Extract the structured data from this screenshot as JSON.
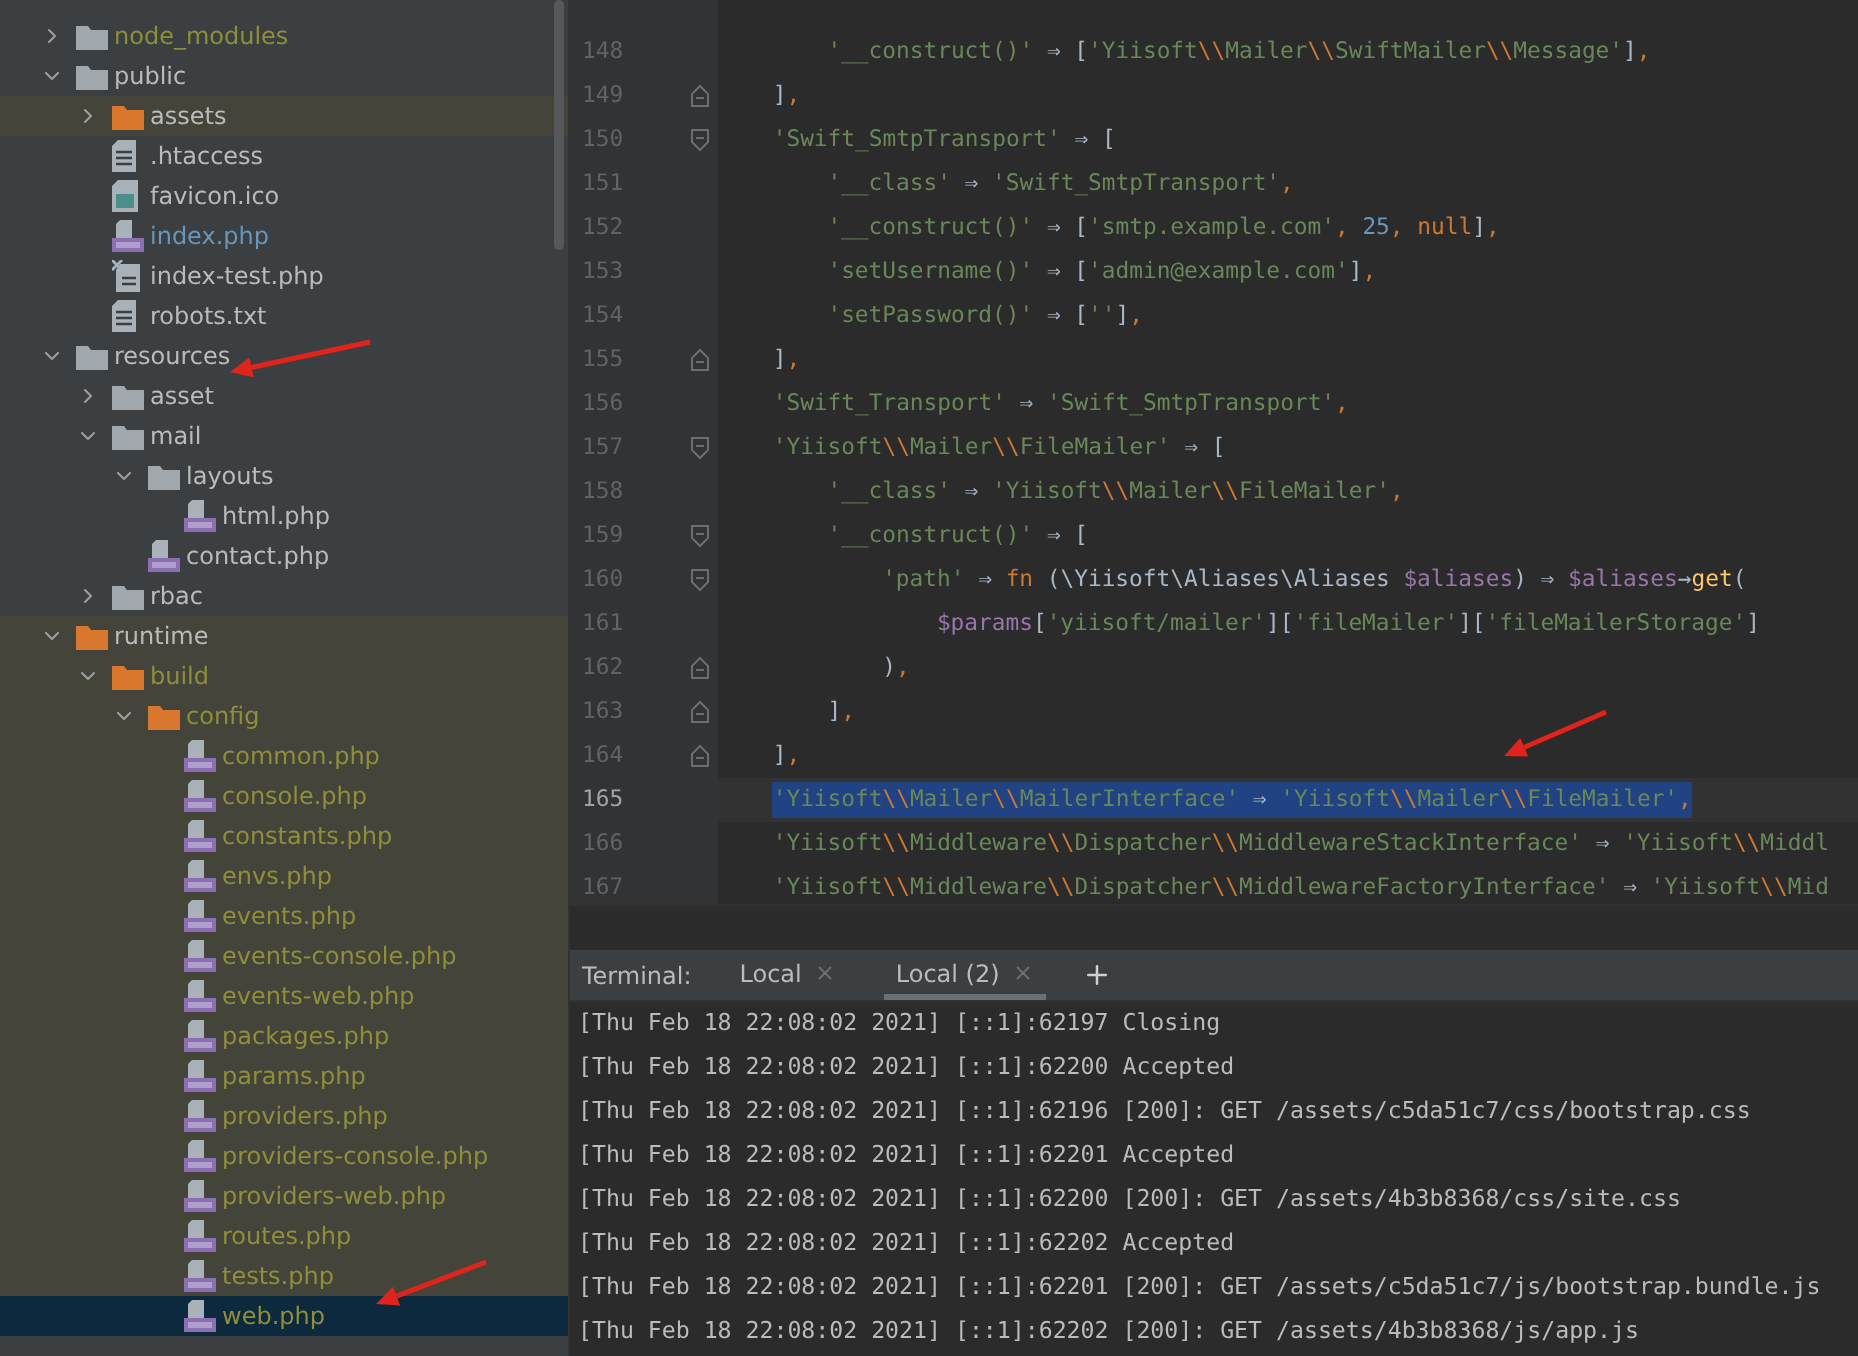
{
  "project_tree": {
    "items": [
      {
        "label": "node_modules",
        "kind": "folder",
        "expanded": false,
        "excluded": false,
        "selected": false,
        "color": "#8f8f3a"
      },
      {
        "label": "public",
        "kind": "folder",
        "expanded": true,
        "excluded": false,
        "selected": false,
        "color": "#bbbbbb",
        "children": [
          {
            "label": "assets",
            "kind": "folder",
            "expanded": false,
            "excluded": true,
            "selected": false,
            "color": "#bbbbbb"
          },
          {
            "label": ".htaccess",
            "kind": "text",
            "selected": false,
            "color": "#bbbbbb"
          },
          {
            "label": "favicon.ico",
            "kind": "image",
            "selected": false,
            "color": "#bbbbbb"
          },
          {
            "label": "index.php",
            "kind": "php",
            "selected": false,
            "color": "#6897bb"
          },
          {
            "label": "index-test.php",
            "kind": "unknown",
            "selected": false,
            "color": "#bbbbbb"
          },
          {
            "label": "robots.txt",
            "kind": "text",
            "selected": false,
            "color": "#bbbbbb"
          }
        ]
      },
      {
        "label": "resources",
        "kind": "folder",
        "expanded": true,
        "excluded": false,
        "selected": false,
        "color": "#bbbbbb",
        "children": [
          {
            "label": "asset",
            "kind": "folder",
            "expanded": false,
            "excluded": false,
            "selected": false,
            "color": "#bbbbbb"
          },
          {
            "label": "mail",
            "kind": "folder",
            "expanded": true,
            "excluded": false,
            "selected": false,
            "color": "#bbbbbb",
            "children": [
              {
                "label": "layouts",
                "kind": "folder",
                "expanded": true,
                "excluded": false,
                "selected": false,
                "color": "#bbbbbb",
                "children": [
                  {
                    "label": "html.php",
                    "kind": "php",
                    "selected": false,
                    "color": "#bbbbbb"
                  }
                ]
              },
              {
                "label": "contact.php",
                "kind": "php",
                "selected": false,
                "color": "#bbbbbb"
              }
            ]
          },
          {
            "label": "rbac",
            "kind": "folder",
            "expanded": false,
            "excluded": false,
            "selected": false,
            "color": "#bbbbbb"
          }
        ]
      },
      {
        "label": "runtime",
        "kind": "folder",
        "expanded": true,
        "excluded": true,
        "selected": false,
        "color": "#bbbbbb",
        "children": [
          {
            "label": "build",
            "kind": "folder",
            "expanded": true,
            "excluded": true,
            "selected": false,
            "color": "#8f8f3a",
            "children": [
              {
                "label": "config",
                "kind": "folder",
                "expanded": true,
                "excluded": true,
                "selected": false,
                "color": "#8f8f3a",
                "children": [
                  {
                    "label": "common.php",
                    "kind": "php",
                    "selected": false,
                    "color": "#8f8f3a"
                  },
                  {
                    "label": "console.php",
                    "kind": "php",
                    "selected": false,
                    "color": "#8f8f3a"
                  },
                  {
                    "label": "constants.php",
                    "kind": "php",
                    "selected": false,
                    "color": "#8f8f3a"
                  },
                  {
                    "label": "envs.php",
                    "kind": "php",
                    "selected": false,
                    "color": "#8f8f3a"
                  },
                  {
                    "label": "events.php",
                    "kind": "php",
                    "selected": false,
                    "color": "#8f8f3a"
                  },
                  {
                    "label": "events-console.php",
                    "kind": "php",
                    "selected": false,
                    "color": "#8f8f3a"
                  },
                  {
                    "label": "events-web.php",
                    "kind": "php",
                    "selected": false,
                    "color": "#8f8f3a"
                  },
                  {
                    "label": "packages.php",
                    "kind": "php",
                    "selected": false,
                    "color": "#8f8f3a"
                  },
                  {
                    "label": "params.php",
                    "kind": "php",
                    "selected": false,
                    "color": "#8f8f3a"
                  },
                  {
                    "label": "providers.php",
                    "kind": "php",
                    "selected": false,
                    "color": "#8f8f3a"
                  },
                  {
                    "label": "providers-console.php",
                    "kind": "php",
                    "selected": false,
                    "color": "#8f8f3a"
                  },
                  {
                    "label": "providers-web.php",
                    "kind": "php",
                    "selected": false,
                    "color": "#8f8f3a"
                  },
                  {
                    "label": "routes.php",
                    "kind": "php",
                    "selected": false,
                    "color": "#8f8f3a"
                  },
                  {
                    "label": "tests.php",
                    "kind": "php",
                    "selected": false,
                    "color": "#8f8f3a"
                  },
                  {
                    "label": "web.php",
                    "kind": "php",
                    "selected": true,
                    "color": "#8f8f3a"
                  }
                ]
              }
            ]
          }
        ]
      }
    ]
  },
  "editor": {
    "lines": [
      {
        "number": "148",
        "fold_start": false,
        "fold_end": false,
        "current": false,
        "selected": false,
        "tokens": [
          {
            "kind": "s",
            "text": "'__construct()'"
          },
          {
            "kind": "p",
            "text": " ⇒ ["
          },
          {
            "kind": "s",
            "text": "'Yiisoft"
          },
          {
            "kind": "e",
            "text": "\\\\"
          },
          {
            "kind": "s",
            "text": "Mailer"
          },
          {
            "kind": "e",
            "text": "\\\\"
          },
          {
            "kind": "s",
            "text": "SwiftMailer"
          },
          {
            "kind": "e",
            "text": "\\\\"
          },
          {
            "kind": "s",
            "text": "Message'"
          },
          {
            "kind": "p",
            "text": "]"
          },
          {
            "kind": "c",
            "text": ","
          }
        ]
      },
      {
        "number": "149",
        "fold_start": false,
        "fold_end": true,
        "current": false,
        "selected": false,
        "tokens": [
          {
            "kind": "p",
            "text": "]"
          },
          {
            "kind": "c",
            "text": ","
          }
        ]
      },
      {
        "number": "150",
        "fold_start": true,
        "fold_end": false,
        "current": false,
        "selected": false,
        "tokens": [
          {
            "kind": "s",
            "text": "'Swift_SmtpTransport'"
          },
          {
            "kind": "p",
            "text": " ⇒ ["
          }
        ]
      },
      {
        "number": "151",
        "fold_start": false,
        "fold_end": false,
        "current": false,
        "selected": false,
        "tokens": [
          {
            "kind": "s",
            "text": "'__class'"
          },
          {
            "kind": "p",
            "text": " ⇒ "
          },
          {
            "kind": "s",
            "text": "'Swift_SmtpTransport'"
          },
          {
            "kind": "c",
            "text": ","
          }
        ]
      },
      {
        "number": "152",
        "fold_start": false,
        "fold_end": false,
        "current": false,
        "selected": false,
        "tokens": [
          {
            "kind": "s",
            "text": "'__construct()'"
          },
          {
            "kind": "p",
            "text": " ⇒ ["
          },
          {
            "kind": "s",
            "text": "'smtp.example.com'"
          },
          {
            "kind": "c",
            "text": ", "
          },
          {
            "kind": "n",
            "text": "25"
          },
          {
            "kind": "c",
            "text": ", "
          },
          {
            "kind": "k",
            "text": "null"
          },
          {
            "kind": "p",
            "text": "]"
          },
          {
            "kind": "c",
            "text": ","
          }
        ]
      },
      {
        "number": "153",
        "fold_start": false,
        "fold_end": false,
        "current": false,
        "selected": false,
        "tokens": [
          {
            "kind": "s",
            "text": "'setUsername()'"
          },
          {
            "kind": "p",
            "text": " ⇒ ["
          },
          {
            "kind": "s",
            "text": "'admin@example.com'"
          },
          {
            "kind": "p",
            "text": "]"
          },
          {
            "kind": "c",
            "text": ","
          }
        ]
      },
      {
        "number": "154",
        "fold_start": false,
        "fold_end": false,
        "current": false,
        "selected": false,
        "tokens": [
          {
            "kind": "s",
            "text": "'setPassword()'"
          },
          {
            "kind": "p",
            "text": " ⇒ ["
          },
          {
            "kind": "s",
            "text": "''"
          },
          {
            "kind": "p",
            "text": "]"
          },
          {
            "kind": "c",
            "text": ","
          }
        ]
      },
      {
        "number": "155",
        "fold_start": false,
        "fold_end": true,
        "current": false,
        "selected": false,
        "tokens": [
          {
            "kind": "p",
            "text": "]"
          },
          {
            "kind": "c",
            "text": ","
          }
        ]
      },
      {
        "number": "156",
        "fold_start": false,
        "fold_end": false,
        "current": false,
        "selected": false,
        "tokens": [
          {
            "kind": "s",
            "text": "'Swift_Transport'"
          },
          {
            "kind": "p",
            "text": " ⇒ "
          },
          {
            "kind": "s",
            "text": "'Swift_SmtpTransport'"
          },
          {
            "kind": "c",
            "text": ","
          }
        ]
      },
      {
        "number": "157",
        "fold_start": true,
        "fold_end": false,
        "current": false,
        "selected": false,
        "tokens": [
          {
            "kind": "s",
            "text": "'Yiisoft"
          },
          {
            "kind": "e",
            "text": "\\\\"
          },
          {
            "kind": "s",
            "text": "Mailer"
          },
          {
            "kind": "e",
            "text": "\\\\"
          },
          {
            "kind": "s",
            "text": "FileMailer'"
          },
          {
            "kind": "p",
            "text": " ⇒ ["
          }
        ]
      },
      {
        "number": "158",
        "fold_start": false,
        "fold_end": false,
        "current": false,
        "selected": false,
        "tokens": [
          {
            "kind": "s",
            "text": "'__class'"
          },
          {
            "kind": "p",
            "text": " ⇒ "
          },
          {
            "kind": "s",
            "text": "'Yiisoft"
          },
          {
            "kind": "e",
            "text": "\\\\"
          },
          {
            "kind": "s",
            "text": "Mailer"
          },
          {
            "kind": "e",
            "text": "\\\\"
          },
          {
            "kind": "s",
            "text": "FileMailer'"
          },
          {
            "kind": "c",
            "text": ","
          }
        ]
      },
      {
        "number": "159",
        "fold_start": true,
        "fold_end": false,
        "current": false,
        "selected": false,
        "tokens": [
          {
            "kind": "s",
            "text": "'__construct()'"
          },
          {
            "kind": "p",
            "text": " ⇒ ["
          }
        ]
      },
      {
        "number": "160",
        "fold_start": true,
        "fold_end": false,
        "current": false,
        "selected": false,
        "tokens": [
          {
            "kind": "s",
            "text": "'path'"
          },
          {
            "kind": "p",
            "text": " ⇒ "
          },
          {
            "kind": "k",
            "text": "fn"
          },
          {
            "kind": "p",
            "text": " (\\Yiisoft\\Aliases\\Aliases "
          },
          {
            "kind": "v",
            "text": "$aliases"
          },
          {
            "kind": "p",
            "text": ") ⇒ "
          },
          {
            "kind": "v",
            "text": "$aliases"
          },
          {
            "kind": "p",
            "text": "→"
          },
          {
            "kind": "f",
            "text": "get"
          },
          {
            "kind": "p",
            "text": "("
          }
        ]
      },
      {
        "number": "161",
        "fold_start": false,
        "fold_end": false,
        "current": false,
        "selected": false,
        "tokens": [
          {
            "kind": "v",
            "text": "$params"
          },
          {
            "kind": "p",
            "text": "["
          },
          {
            "kind": "s",
            "text": "'yiisoft/mailer'"
          },
          {
            "kind": "p",
            "text": "]["
          },
          {
            "kind": "s",
            "text": "'fileMailer'"
          },
          {
            "kind": "p",
            "text": "]["
          },
          {
            "kind": "s",
            "text": "'fileMailerStorage'"
          },
          {
            "kind": "p",
            "text": "]"
          }
        ]
      },
      {
        "number": "162",
        "fold_start": false,
        "fold_end": true,
        "current": false,
        "selected": false,
        "tokens": [
          {
            "kind": "p",
            "text": ")"
          },
          {
            "kind": "c",
            "text": ","
          }
        ]
      },
      {
        "number": "163",
        "fold_start": false,
        "fold_end": true,
        "current": false,
        "selected": false,
        "tokens": [
          {
            "kind": "p",
            "text": "]"
          },
          {
            "kind": "c",
            "text": ","
          }
        ]
      },
      {
        "number": "164",
        "fold_start": false,
        "fold_end": true,
        "current": false,
        "selected": false,
        "tokens": [
          {
            "kind": "p",
            "text": "]"
          },
          {
            "kind": "c",
            "text": ","
          }
        ]
      },
      {
        "number": "165",
        "fold_start": false,
        "fold_end": false,
        "current": true,
        "selected": true,
        "tokens": [
          {
            "kind": "s",
            "text": "'Yiisoft"
          },
          {
            "kind": "e",
            "text": "\\\\"
          },
          {
            "kind": "s",
            "text": "Mailer"
          },
          {
            "kind": "e",
            "text": "\\\\"
          },
          {
            "kind": "s",
            "text": "MailerInterface'"
          },
          {
            "kind": "p",
            "text": " ⇒ "
          },
          {
            "kind": "s",
            "text": "'Yiisoft"
          },
          {
            "kind": "e",
            "text": "\\\\"
          },
          {
            "kind": "s",
            "text": "Mailer"
          },
          {
            "kind": "e",
            "text": "\\\\"
          },
          {
            "kind": "s",
            "text": "FileMailer'"
          },
          {
            "kind": "c",
            "text": ","
          }
        ]
      },
      {
        "number": "166",
        "fold_start": false,
        "fold_end": false,
        "current": false,
        "selected": false,
        "tokens": [
          {
            "kind": "s",
            "text": "'Yiisoft"
          },
          {
            "kind": "e",
            "text": "\\\\"
          },
          {
            "kind": "s",
            "text": "Middleware"
          },
          {
            "kind": "e",
            "text": "\\\\"
          },
          {
            "kind": "s",
            "text": "Dispatcher"
          },
          {
            "kind": "e",
            "text": "\\\\"
          },
          {
            "kind": "s",
            "text": "MiddlewareStackInterface'"
          },
          {
            "kind": "p",
            "text": " ⇒ "
          },
          {
            "kind": "s",
            "text": "'Yiisoft"
          },
          {
            "kind": "e",
            "text": "\\\\"
          },
          {
            "kind": "s",
            "text": "Middl"
          }
        ]
      },
      {
        "number": "167",
        "fold_start": false,
        "fold_end": false,
        "current": false,
        "selected": false,
        "tokens": [
          {
            "kind": "s",
            "text": "'Yiisoft"
          },
          {
            "kind": "e",
            "text": "\\\\"
          },
          {
            "kind": "s",
            "text": "Middleware"
          },
          {
            "kind": "e",
            "text": "\\\\"
          },
          {
            "kind": "s",
            "text": "Dispatcher"
          },
          {
            "kind": "e",
            "text": "\\\\"
          },
          {
            "kind": "s",
            "text": "MiddlewareFactoryInterface'"
          },
          {
            "kind": "p",
            "text": " ⇒ "
          },
          {
            "kind": "s",
            "text": "'Yiisoft"
          },
          {
            "kind": "e",
            "text": "\\\\"
          },
          {
            "kind": "s",
            "text": "Mid"
          }
        ]
      }
    ]
  },
  "terminal": {
    "label": "Terminal:",
    "tabs": [
      {
        "label": "Local",
        "selected": false
      },
      {
        "label": "Local (2)",
        "selected": true
      }
    ],
    "lines": [
      "[Thu Feb 18 22:08:02 2021] [::1]:62197 Closing",
      "[Thu Feb 18 22:08:02 2021] [::1]:62200 Accepted",
      "[Thu Feb 18 22:08:02 2021] [::1]:62196 [200]: GET /assets/c5da51c7/css/bootstrap.css",
      "[Thu Feb 18 22:08:02 2021] [::1]:62201 Accepted",
      "[Thu Feb 18 22:08:02 2021] [::1]:62200 [200]: GET /assets/4b3b8368/css/site.css",
      "[Thu Feb 18 22:08:02 2021] [::1]:62202 Accepted",
      "[Thu Feb 18 22:08:02 2021] [::1]:62201 [200]: GET /assets/c5da51c7/js/bootstrap.bundle.js",
      "[Thu Feb 18 22:08:02 2021] [::1]:62202 [200]: GET /assets/4b3b8368/js/app.js"
    ]
  }
}
